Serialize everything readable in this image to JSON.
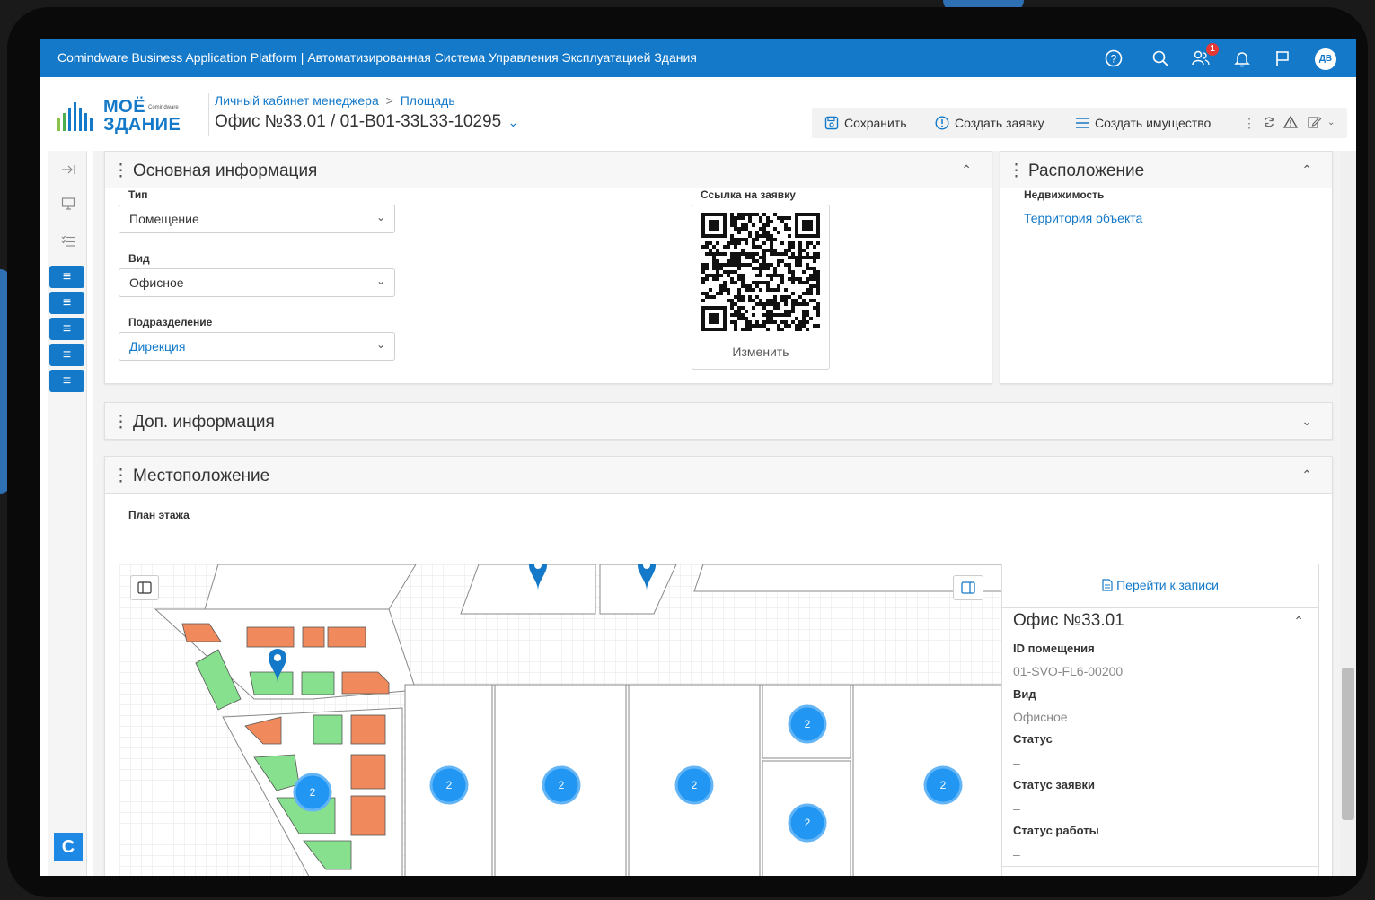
{
  "topbar": {
    "title": "Comindware Business Application Platform | Автоматизированная Система Управления Эксплуатацией Здания",
    "notification_count": "1",
    "avatar_initials": "ДВ",
    "color": "#1479c8"
  },
  "logo": {
    "line1": "МОЁ",
    "line2": "ЗДАНИЕ",
    "brand": "Comindware"
  },
  "header": {
    "breadcrumb_1": "Личный кабинет менеджера",
    "breadcrumb_sep": ">",
    "breadcrumb_2": "Площадь",
    "record_title": "Офис №33.01 / 01-B01-33L33-10295"
  },
  "toolbar": {
    "save_label": "Сохранить",
    "create_request_label": "Создать заявку",
    "create_asset_label": "Создать имущество"
  },
  "main_info": {
    "title": "Основная информация",
    "type_label": "Тип",
    "type_value": "Помещение",
    "kind_label": "Вид",
    "kind_value": "Офисное",
    "division_label": "Подразделение",
    "division_value": "Дирекция",
    "qr_label": "Ссылка на заявку",
    "qr_change_label": "Изменить"
  },
  "location_panel": {
    "title": "Расположение",
    "realty_label": "Недвижимость",
    "realty_value": "Территория объекта"
  },
  "extra_info": {
    "title": "Доп. информация"
  },
  "position_panel": {
    "title": "Местоположение",
    "floor_plan_label": "План этажа"
  },
  "map": {
    "cluster_count": "2"
  },
  "side_panel": {
    "goto_label": "Перейти к записи",
    "title": "Офис №33.01",
    "id_label": "ID помещения",
    "id_value": "01-SVO-FL6-00200",
    "kind_label": "Вид",
    "kind_value": "Офисное",
    "status_label": "Статус",
    "status_value": "–",
    "request_status_label": "Статус заявки",
    "request_status_value": "–",
    "work_status_label": "Статус работы",
    "work_status_value": "–"
  },
  "rail": {
    "logo_letter": "C"
  }
}
